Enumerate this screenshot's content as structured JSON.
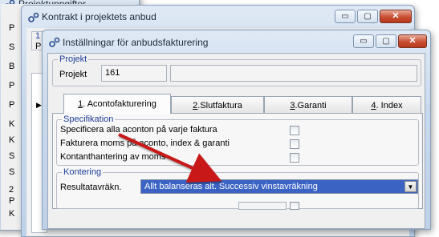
{
  "back_window": {
    "title": "Projektuppgifter",
    "side_letters": [
      "P",
      "S",
      "B",
      "P",
      "P",
      "K",
      "K",
      "S",
      "S",
      "2",
      "P",
      "K"
    ],
    "side_tab": "1",
    "side_tab2": "2",
    "side_tab3": "2"
  },
  "mid_window": {
    "title": "Kontrakt i projektets anbud",
    "fragment_1": "1 Projekt",
    "fragment_2": "P"
  },
  "front_window": {
    "title": "Inställningar för anbudsfakturering",
    "project_group": {
      "title": "Projekt",
      "label": "Projekt",
      "number": "161",
      "name": ""
    },
    "tabs": [
      {
        "num": "1",
        "label": ". Acontofakturering"
      },
      {
        "num": "2",
        "label": ".Slutfaktura"
      },
      {
        "num": "3",
        "label": ".Garanti"
      },
      {
        "num": "4",
        "label": ". Index"
      }
    ],
    "spec_group": {
      "title": "Specifikation",
      "rows": [
        {
          "label": "Specificera alla aconton på varje faktura",
          "checked": false
        },
        {
          "label": "Fakturera moms på aconto, index & garanti",
          "checked": false
        },
        {
          "label": "Kontanthantering av moms",
          "checked": false
        }
      ]
    },
    "kontering_group": {
      "title": "Kontering",
      "label": "Resultatavräkn.",
      "selected": "Allt balanseras alt. Successiv vinstavräkning"
    }
  },
  "window_buttons": {
    "minimize": "▭",
    "maximize": "▢",
    "close": "✕"
  }
}
